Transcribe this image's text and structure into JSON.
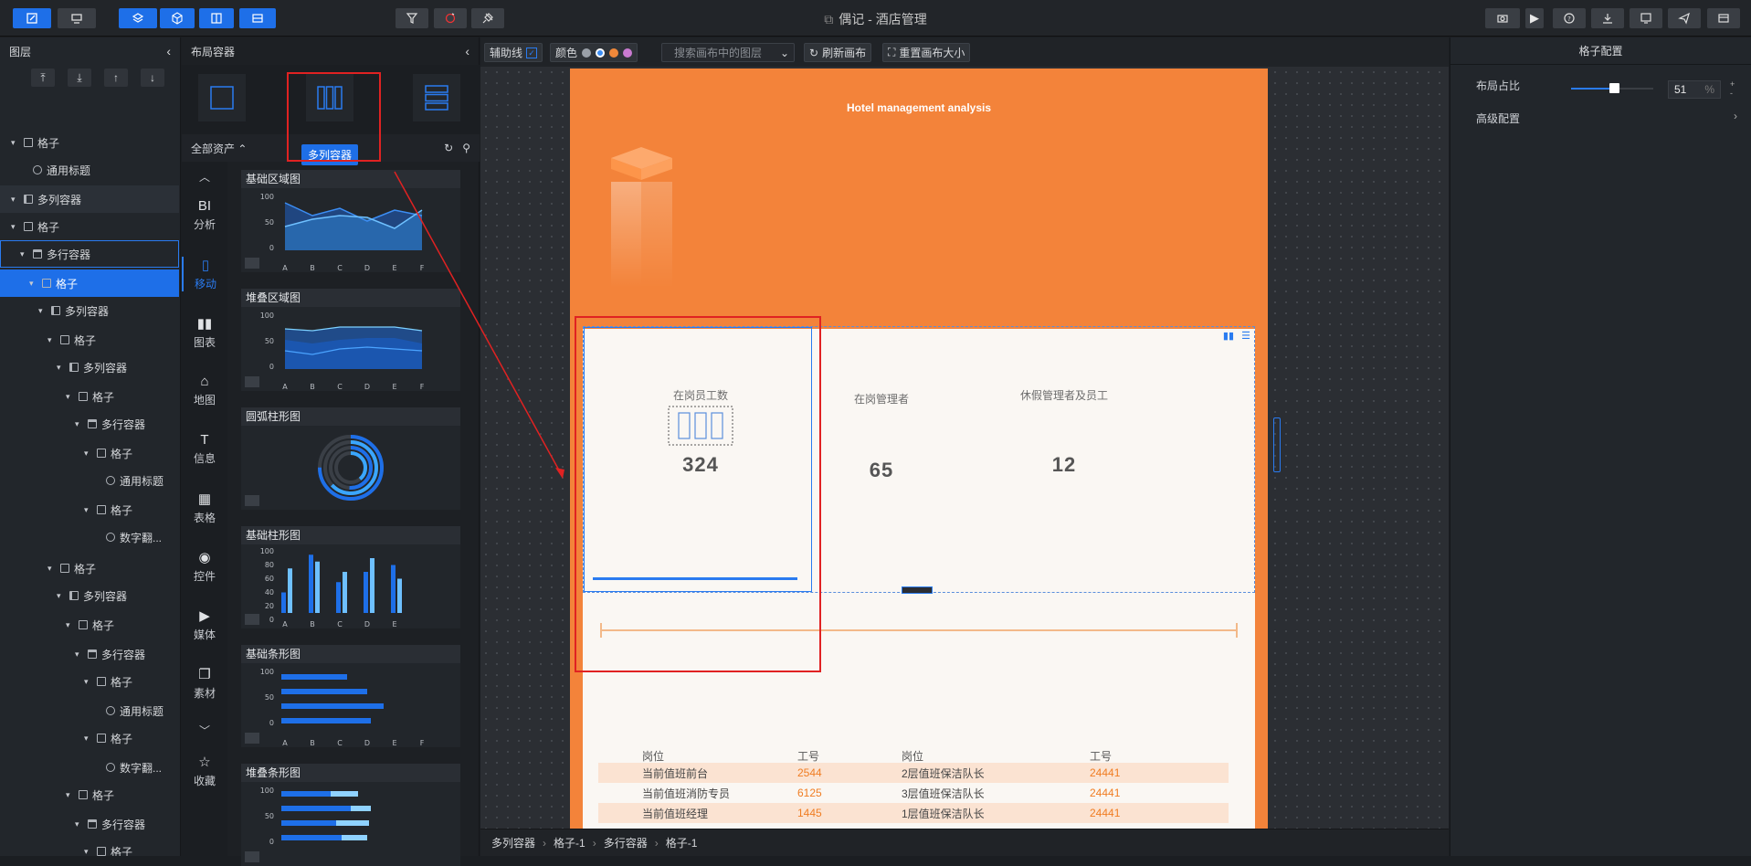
{
  "app": {
    "title": "偶记 - 酒店管理"
  },
  "layers_panel": {
    "title": "图层",
    "rows": [
      {
        "label": "格子",
        "indent": 0
      },
      {
        "label": "通用标题",
        "indent": 1
      },
      {
        "label": "多列容器",
        "indent": 0
      },
      {
        "label": "格子",
        "indent": 0
      },
      {
        "label": "多行容器",
        "indent": 1
      },
      {
        "label": "格子",
        "indent": 2
      },
      {
        "label": "多列容器",
        "indent": 3
      },
      {
        "label": "格子",
        "indent": 4
      },
      {
        "label": "多列容器",
        "indent": 5
      },
      {
        "label": "格子",
        "indent": 6
      },
      {
        "label": "多行容器",
        "indent": 7
      },
      {
        "label": "格子",
        "indent": 8
      },
      {
        "label": "通用标题",
        "indent": 9
      },
      {
        "label": "格子",
        "indent": 8
      },
      {
        "label": "数字翻...",
        "indent": 9
      },
      {
        "label": "格子",
        "indent": 4
      },
      {
        "label": "多列容器",
        "indent": 5
      },
      {
        "label": "格子",
        "indent": 6
      },
      {
        "label": "多行容器",
        "indent": 7
      },
      {
        "label": "格子",
        "indent": 8
      },
      {
        "label": "通用标题",
        "indent": 9
      },
      {
        "label": "格子",
        "indent": 8
      },
      {
        "label": "数字翻...",
        "indent": 9
      },
      {
        "label": "格子",
        "indent": 6
      },
      {
        "label": "多行容器",
        "indent": 7
      },
      {
        "label": "格子",
        "indent": 8
      },
      {
        "label": "通用标题",
        "indent": 9
      }
    ]
  },
  "assets_panel": {
    "title": "布局容器",
    "filter_label": "全部资产",
    "tooltip": "多列容器",
    "categories": [
      "分析",
      "移动",
      "图表",
      "地图",
      "信息",
      "表格",
      "控件",
      "媒体",
      "素材",
      "收藏"
    ],
    "category_icons": [
      "BI",
      "▯",
      "▮▮",
      "⌂",
      "T",
      "▦",
      "◉",
      "▶",
      "❐",
      "☆"
    ],
    "cards": [
      {
        "title": "基础区域图",
        "x": [
          "A",
          "B",
          "C",
          "D",
          "E",
          "F"
        ],
        "y": [
          "100",
          "50",
          "0"
        ]
      },
      {
        "title": "堆叠区域图",
        "x": [
          "A",
          "B",
          "C",
          "D",
          "E",
          "F"
        ],
        "y": [
          "100",
          "50",
          "0"
        ]
      },
      {
        "title": "圆弧柱形图"
      },
      {
        "title": "基础柱形图",
        "x": [
          "A",
          "B",
          "C",
          "D",
          "E"
        ],
        "y": [
          "100",
          "80",
          "60",
          "40",
          "20",
          "0"
        ]
      },
      {
        "title": "基础条形图",
        "x": [
          "A",
          "B",
          "C",
          "D",
          "E",
          "F"
        ],
        "y": [
          "100",
          "50",
          "0"
        ]
      },
      {
        "title": "堆叠条形图",
        "y": [
          "100",
          "50",
          "0"
        ]
      }
    ]
  },
  "canvas_toolbar": {
    "guides_label": "辅助线",
    "color_label": "颜色",
    "search_placeholder": "搜索画布中的图层",
    "refresh_label": "刷新画布",
    "reset_label": "重置画布大小"
  },
  "page": {
    "title": "Hotel management analysis",
    "tiles": [
      {
        "label": "在岗员工数",
        "value": "324"
      },
      {
        "label": "在岗管理者",
        "value": "65"
      },
      {
        "label": "休假管理者及员工",
        "value": "12"
      }
    ],
    "table": {
      "headers": [
        "岗位",
        "工号",
        "岗位",
        "工号"
      ],
      "rows": [
        [
          "当前值班前台",
          "2544",
          "2层值班保洁队长",
          "24441"
        ],
        [
          "当前值班消防专员",
          "6125",
          "3层值班保洁队长",
          "24441"
        ],
        [
          "当前值班经理",
          "1445",
          "1层值班保洁队长",
          "24441"
        ]
      ]
    }
  },
  "breadcrumb": [
    "多列容器",
    "格子-1",
    "多行容器",
    "格子-1"
  ],
  "config_panel": {
    "title": "格子配置",
    "ratio_label": "布局占比",
    "ratio_value": "51",
    "ratio_unit": "%",
    "advanced_label": "高级配置"
  },
  "colors": {
    "accent": "#1e6fe8",
    "page_orange": "#f3833a",
    "highlight_red": "#e02222",
    "value_orange": "#f07d22"
  }
}
